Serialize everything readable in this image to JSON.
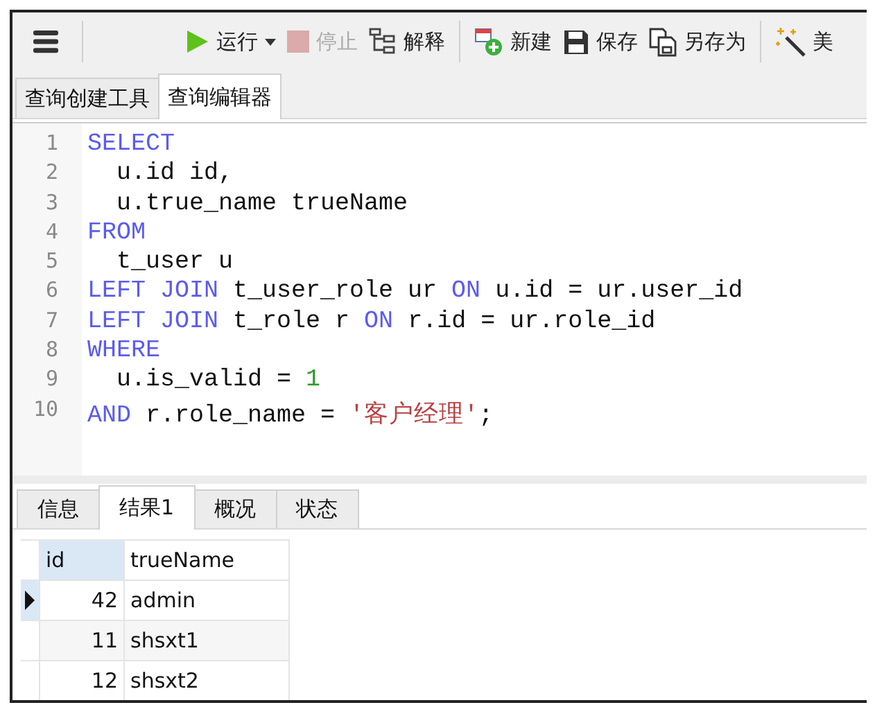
{
  "toolbar": {
    "items": [
      {
        "kind": "menu"
      },
      {
        "kind": "run",
        "label": "运行",
        "disabled": false,
        "dropdown": true
      },
      {
        "kind": "stop",
        "label": "停止",
        "disabled": true
      },
      {
        "kind": "explain",
        "label": "解释",
        "disabled": false
      },
      {
        "kind": "new",
        "label": "新建",
        "disabled": false
      },
      {
        "kind": "save",
        "label": "保存",
        "disabled": false
      },
      {
        "kind": "save_as",
        "label": "另存为",
        "disabled": false
      },
      {
        "kind": "beautify",
        "label": "美",
        "disabled": false
      }
    ]
  },
  "editor_tabs": [
    {
      "label": "查询创建工具",
      "selected": false
    },
    {
      "label": "查询编辑器",
      "selected": true
    }
  ],
  "editor": {
    "lines": [
      {
        "number": "1",
        "tokens": [
          {
            "kind": "keyword",
            "text": "SELECT"
          }
        ]
      },
      {
        "number": "2",
        "tokens": [
          {
            "kind": "text",
            "text": "  u.id id,"
          }
        ]
      },
      {
        "number": "3",
        "tokens": [
          {
            "kind": "text",
            "text": "  u.true_name trueName"
          }
        ]
      },
      {
        "number": "4",
        "tokens": [
          {
            "kind": "keyword",
            "text": "FROM"
          }
        ]
      },
      {
        "number": "5",
        "tokens": [
          {
            "kind": "text",
            "text": "  t_user u"
          }
        ]
      },
      {
        "number": "6",
        "tokens": [
          {
            "kind": "keyword",
            "text": "LEFT JOIN"
          },
          {
            "kind": "text",
            "text": " t_user_role ur "
          },
          {
            "kind": "keyword",
            "text": "ON"
          },
          {
            "kind": "text",
            "text": " u.id = ur.user_id"
          }
        ]
      },
      {
        "number": "7",
        "tokens": [
          {
            "kind": "keyword",
            "text": "LEFT JOIN"
          },
          {
            "kind": "text",
            "text": " t_role r "
          },
          {
            "kind": "keyword",
            "text": "ON"
          },
          {
            "kind": "text",
            "text": " r.id = ur.role_id"
          }
        ]
      },
      {
        "number": "8",
        "tokens": [
          {
            "kind": "keyword",
            "text": "WHERE"
          }
        ]
      },
      {
        "number": "9",
        "tokens": [
          {
            "kind": "text",
            "text": "  u.is_valid = "
          },
          {
            "kind": "number",
            "text": "1"
          }
        ]
      },
      {
        "number": "10",
        "tokens": [
          {
            "kind": "keyword",
            "text": "AND"
          },
          {
            "kind": "text",
            "text": " r.role_name = "
          },
          {
            "kind": "string",
            "text": "'客户经理'"
          },
          {
            "kind": "text",
            "text": ";"
          }
        ]
      }
    ]
  },
  "result_tabs": [
    {
      "label": "信息",
      "selected": false
    },
    {
      "label": "结果1",
      "selected": true
    },
    {
      "label": "概况",
      "selected": false
    },
    {
      "label": "状态",
      "selected": false
    }
  ],
  "table": {
    "columns": [
      {
        "label": "id",
        "selected": true
      },
      {
        "label": "trueName",
        "selected": false
      }
    ],
    "rows": [
      {
        "cells": [
          "42",
          "admin"
        ],
        "selected": true
      },
      {
        "cells": [
          "11",
          "shsxt1"
        ],
        "selected": false
      },
      {
        "cells": [
          "12",
          "shsxt2"
        ],
        "selected": false
      }
    ]
  }
}
